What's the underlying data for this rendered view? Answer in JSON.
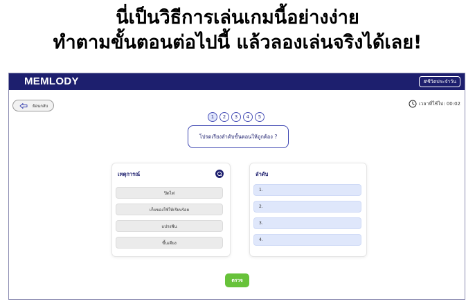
{
  "headline": {
    "line1": "นี่เป็นวิธีการเล่นเกมนี้อย่างง่าย",
    "line2": "ทำตามขั้นตอนต่อไปนี้ แล้วลองเล่นจริงได้เลย!"
  },
  "app": {
    "brand": "MEMLODY",
    "tag_button": "#ชีวิตประจำวัน",
    "back_button": "ย้อนกลับ",
    "timer_text": "เวลาที่ใช้ไป: 00:02"
  },
  "steps": [
    "1",
    "2",
    "3",
    "4",
    "5"
  ],
  "current_step": 1,
  "question": "โปรดเรียงลำดับขั้นตอนให้ถูกต้อง ?",
  "events_card": {
    "title": "เหตุการณ์",
    "items": [
      "ปิดไฟ",
      "เก็บของใช้ให้เรียบร้อย",
      "แปรงฟัน",
      "ขึ้นเตียง"
    ]
  },
  "order_card": {
    "title": "ลำดับ",
    "slots": [
      "1.",
      "2.",
      "3.",
      "4."
    ]
  },
  "check_button": "ตรวจ",
  "colors": {
    "navy": "#1d1f6e",
    "slot_blue": "#dfe7fb",
    "check_green": "#67c23a"
  }
}
